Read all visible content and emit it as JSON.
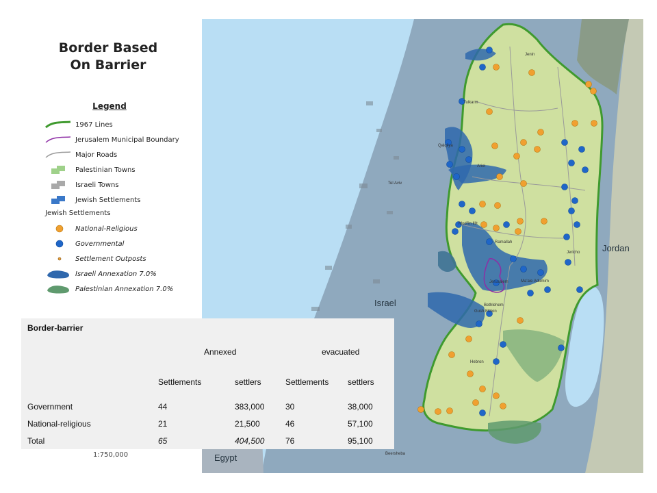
{
  "title": {
    "line1": "Border Based",
    "line2": "On Barrier"
  },
  "legend": {
    "heading": "Legend",
    "items": [
      {
        "label": "1967 Lines",
        "color": "#3f9a2e"
      },
      {
        "label": "Jerusalem Municipal Boundary",
        "color": "#8e2ea5"
      },
      {
        "label": "Major Roads",
        "color": "#9a9a9a"
      },
      {
        "label": "Palestinian Towns",
        "color": "#9fd18a"
      },
      {
        "label": "Israeli Towns",
        "color": "#a9a9a9"
      },
      {
        "label": "Jewish Settlements",
        "color": "#3a78c8"
      }
    ],
    "subheading": "Jewish Settlements",
    "settlement_items": [
      {
        "label": "National-Religious",
        "color": "#f0a030"
      },
      {
        "label": "Governmental",
        "color": "#1f66c8"
      },
      {
        "label": "Settlement Outposts",
        "color": "#e8a23c"
      },
      {
        "label": "Israeli Annexation 7.0%",
        "color": "#2f68ad"
      },
      {
        "label": "Palestinian Annexation 7.0%",
        "color": "#5f9a6e"
      }
    ]
  },
  "scale": "1:750,000",
  "map_labels": {
    "israel": "Israel",
    "jordan": "Jordan",
    "egypt": "Egypt",
    "jenin": "Jenin",
    "tulkarm": "Tulkarm",
    "tel_aviv": "Tel Aviv",
    "ariel": "Ariel",
    "modiin": "Modi'in Illit",
    "ramallah": "Ramallah",
    "jericho": "Jericho",
    "jerusalem": "Jerusalem",
    "maale_adumim": "Ma'ale Adumim",
    "bethlehem": "Bethlehem",
    "gush_etzion": "Gush Etzion",
    "hebron": "Hebron",
    "beersheba": "Beersheba",
    "qalqilya": "Qalqilya"
  },
  "colors": {
    "sea": "#b9def4",
    "israel": "#8fa9be",
    "west_bank": "#cfe0a0",
    "green_line": "#3f9a2e",
    "jordan": "#c4c9b4",
    "dead_sea": "#b9def4",
    "national_religious": "#f0a030",
    "governmental": "#1f66c8"
  },
  "table": {
    "title": "Border-barrier",
    "group_annexed": "Annexed",
    "group_evacuated": "evacuated",
    "columns": [
      "Settlements",
      "settlers",
      "Settlements",
      "settlers"
    ],
    "rows": [
      {
        "label": "Government",
        "cells": [
          "44",
          "383,000",
          "30",
          "38,000"
        ]
      },
      {
        "label": "National-religious",
        "cells": [
          "21",
          "21,500",
          "46",
          "57,100"
        ]
      },
      {
        "label": "Total",
        "cells": [
          "65",
          "404,500",
          "76",
          "95,100"
        ]
      }
    ]
  }
}
